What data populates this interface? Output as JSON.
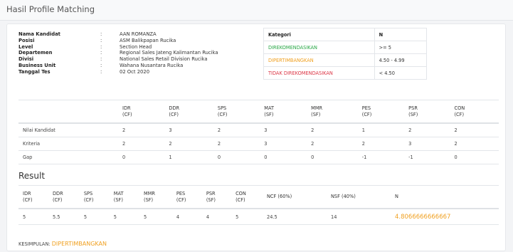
{
  "page": {
    "title": "Hasil Profile Matching"
  },
  "candidate": [
    {
      "label": "Nama Kandidat",
      "sep": ":",
      "value": "AAN ROMANZA"
    },
    {
      "label": "Posisi",
      "sep": ":",
      "value": "ASM Balikpapan Rucika"
    },
    {
      "label": "Level",
      "sep": ":",
      "value": "Section Head"
    },
    {
      "label": "Departemen",
      "sep": ":",
      "value": "Regional Sales Jateng Kalimantan Rucika"
    },
    {
      "label": "Divisi",
      "sep": ":",
      "value": "National Sales Retail Division Rucika"
    },
    {
      "label": "Business Unit",
      "sep": ":",
      "value": "Wahana Nusantara Rucika"
    },
    {
      "label": "Tanggal Tes",
      "sep": ":",
      "value": "02 Oct 2020"
    }
  ],
  "kategori": {
    "header": [
      "Kategori",
      "N"
    ],
    "rows": [
      {
        "label": "DIREKOMENDASIKAN",
        "range": ">= 5",
        "color": "#28a745"
      },
      {
        "label": "DIPERTIMBANGKAN",
        "range": "4.50 - 4.99",
        "color": "#f0a020"
      },
      {
        "label": "TIDAK DIREKOMENDASIKAN",
        "range": "< 4.50",
        "color": "#dc3545"
      }
    ]
  },
  "scores": {
    "columns": [
      {
        "code": "IDR",
        "type": "(CF)"
      },
      {
        "code": "DDR",
        "type": "(CF)"
      },
      {
        "code": "SPS",
        "type": "(CF)"
      },
      {
        "code": "MAT",
        "type": "(SF)"
      },
      {
        "code": "MMR",
        "type": "(SF)"
      },
      {
        "code": "PES",
        "type": "(CF)"
      },
      {
        "code": "PSR",
        "type": "(SF)"
      },
      {
        "code": "CON",
        "type": "(CF)"
      }
    ],
    "rows": [
      {
        "label": "Nilai Kandidat",
        "values": [
          "2",
          "3",
          "2",
          "3",
          "2",
          "1",
          "2",
          "2"
        ]
      },
      {
        "label": "Kriteria",
        "values": [
          "2",
          "2",
          "2",
          "3",
          "2",
          "2",
          "3",
          "2"
        ]
      },
      {
        "label": "Gap",
        "values": [
          "0",
          "1",
          "0",
          "0",
          "0",
          "-1",
          "-1",
          "0"
        ]
      }
    ]
  },
  "result": {
    "title": "Result",
    "columns": [
      {
        "code": "IDR",
        "type": "(CF)"
      },
      {
        "code": "DDR",
        "type": "(CF)"
      },
      {
        "code": "SPS",
        "type": "(CF)"
      },
      {
        "code": "MAT",
        "type": "(SF)"
      },
      {
        "code": "MMR",
        "type": "(SF)"
      },
      {
        "code": "PES",
        "type": "(CF)"
      },
      {
        "code": "PSR",
        "type": "(SF)"
      },
      {
        "code": "CON",
        "type": "(CF)"
      }
    ],
    "ncf_header": "NCF (60%)",
    "nsf_header": "NSF (40%)",
    "n_header": "N",
    "values": [
      "5",
      "5.5",
      "5",
      "5",
      "5",
      "4",
      "4",
      "5"
    ],
    "ncf": "24.5",
    "nsf": "14",
    "n": "4.8066666666667"
  },
  "conclusion": {
    "label": "KESIMPULAN:",
    "status": "DIPERTIMBANGKAN",
    "color": "#f0a020"
  }
}
